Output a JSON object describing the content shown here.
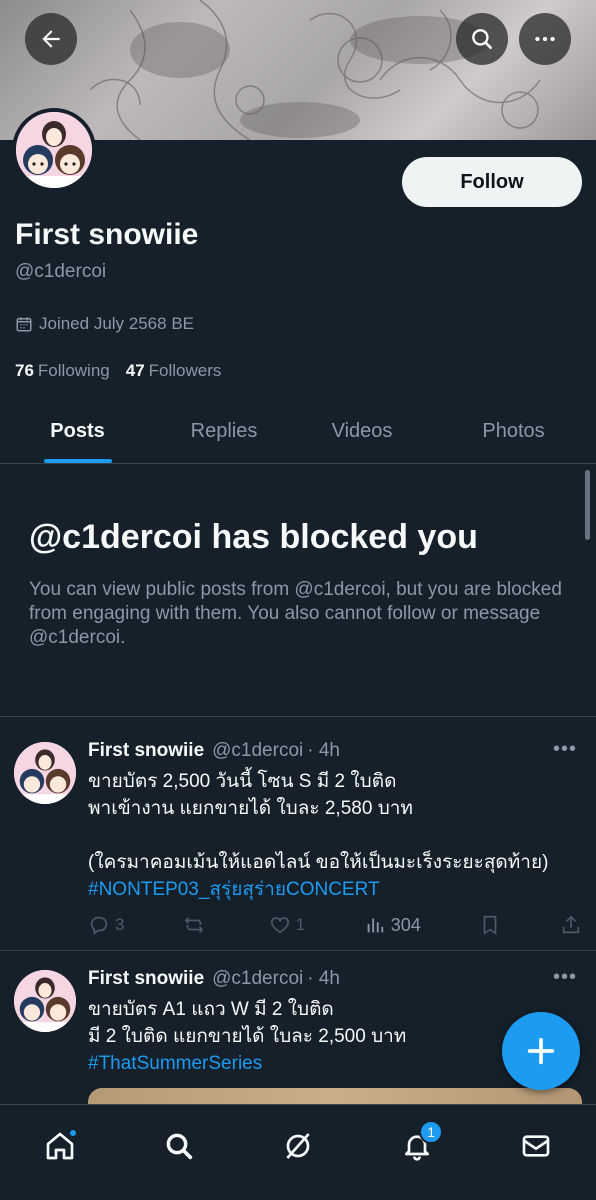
{
  "banner": {
    "back_icon": "arrow-left-icon",
    "search_icon": "search-icon",
    "more_icon": "more-horizontal-icon"
  },
  "profile": {
    "name": "First snowiie",
    "handle": "@c1dercoi",
    "follow_label": "Follow",
    "joined": "Joined July 2568 BE",
    "following_count": "76",
    "following_label": "Following",
    "followers_count": "47",
    "followers_label": "Followers"
  },
  "tabs": [
    {
      "label": "Posts",
      "active": true
    },
    {
      "label": "Replies",
      "active": false
    },
    {
      "label": "Videos",
      "active": false
    },
    {
      "label": "Photos",
      "active": false
    }
  ],
  "blocked": {
    "title": "@c1dercoi has blocked you",
    "text": "You can view public posts from @c1dercoi, but you are blocked from engaging with them. You also cannot follow or message @c1dercoi."
  },
  "posts": [
    {
      "name": "First snowiie",
      "handle": "@c1dercoi",
      "time": "· 4h",
      "line1": "ขายบัตร 2,500 วันนี้ โซน S มี 2 ใบติด",
      "line2": "พาเข้างาน แยกขายได้ ใบละ 2,580 บาท",
      "line3": "(ใครมาคอมเม้นให้แอดไลน์ ขอให้เป็นมะเร็งระยะสุดท้าย)",
      "hashtag": "#NONTEP03_สุรุ่ยสุร่ายCONCERT",
      "replies": "3",
      "reposts": "",
      "likes": "1",
      "views": "304"
    },
    {
      "name": "First snowiie",
      "handle": "@c1dercoi",
      "time": "· 4h",
      "line1": "ขายบัตร A1 แถว W มี 2 ใบติด",
      "line2": "มี 2 ใบติด แยกขายได้ ใบละ 2,500 บาท",
      "hashtag": "#ThatSummerSeries"
    }
  ],
  "nav": {
    "notifications_badge": "1"
  },
  "colors": {
    "background": "#15202b",
    "accent": "#1d9bf0",
    "muted": "#8b98a5",
    "divider": "#38444d"
  }
}
